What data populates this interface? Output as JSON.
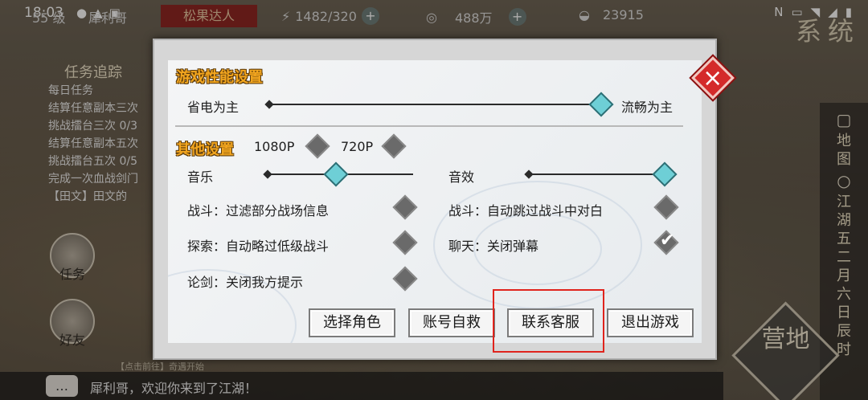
{
  "status_bar": {
    "time": "18:03",
    "notif_icons": [
      "chat-app-icon",
      "mail-icon",
      "gallery-icon"
    ],
    "sys_icons": [
      "nfc-icon",
      "volte-icon",
      "wifi-icon",
      "signal-icon",
      "battery-icon"
    ]
  },
  "hud": {
    "level": "55 级",
    "player_name": "犀利哥",
    "title_badge": "松果达人",
    "stamina": "1482/320",
    "coins": "488万",
    "ingots": "23915"
  },
  "corner_title": "系统",
  "quest_panel": {
    "title": "任务追踪",
    "items": [
      "每日任务",
      "结算任意副本三次",
      "挑战擂台三次 0/3",
      "结算任意副本五次",
      "挑战擂台五次 0/5",
      "完成一次血战剑门",
      "【田文】田文的"
    ]
  },
  "left_icons": [
    "任务",
    "好友"
  ],
  "right_rail": {
    "map_label": "地图",
    "date_text": "江湖五二月六日辰时"
  },
  "camp_label": "营地",
  "chat": {
    "hint": "【点击前往】奇遇开始",
    "message": "犀利哥，欢迎你来到了江湖！"
  },
  "dialog": {
    "performance_title": "游戏性能设置",
    "power_save_label": "省电为主",
    "smooth_label": "流畅为主",
    "performance_level": 1.0,
    "other_title": "其他设置",
    "res_1080": "1080P",
    "res_720": "720P",
    "music_label": "音乐",
    "music_level": 0.47,
    "sfx_label": "音效",
    "sfx_level": 1.0,
    "options": [
      {
        "label": "战斗：过滤部分战场信息",
        "checked": false
      },
      {
        "label": "战斗：自动跳过战斗中对白",
        "checked": false
      },
      {
        "label": "探索：自动略过低级战斗",
        "checked": false
      },
      {
        "label": "聊天：关闭弹幕",
        "checked": true
      },
      {
        "label": "论剑：关闭我方提示",
        "checked": false
      }
    ],
    "buttons": {
      "select_role": "选择角色",
      "account_rescue": "账号自救",
      "contact_support": "联系客服",
      "exit_game": "退出游戏"
    }
  },
  "colors": {
    "section_title": "#f3a61f",
    "knob": "#6ecfd6",
    "close": "#d42a2a",
    "highlight": "#e0241d"
  }
}
